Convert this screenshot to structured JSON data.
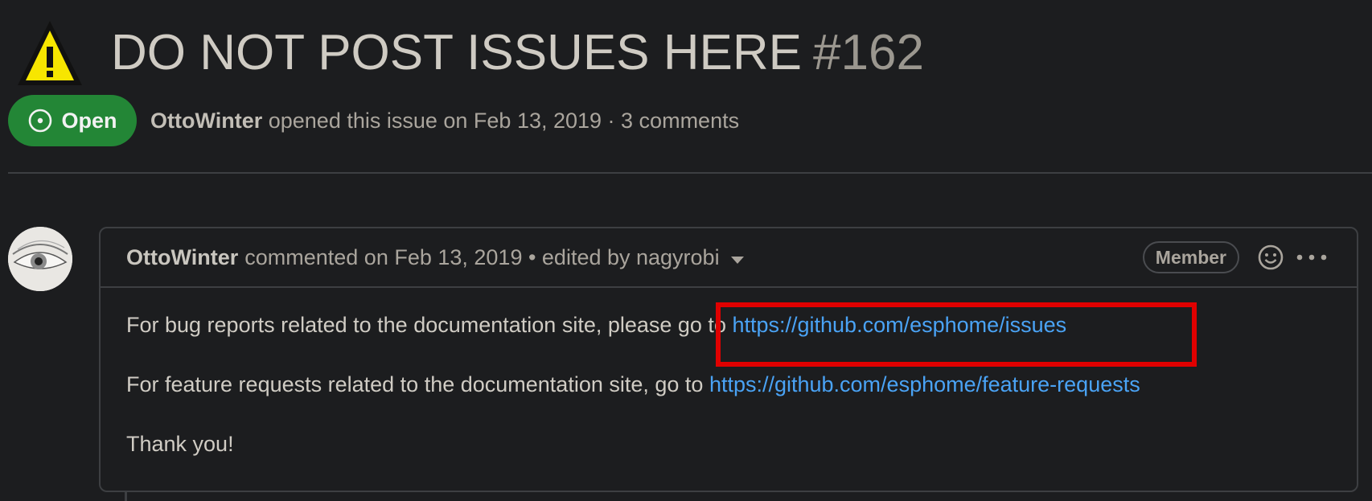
{
  "issue": {
    "title": "DO NOT POST ISSUES HERE",
    "number": "#162",
    "state": "Open",
    "state_color": "#238636",
    "author": "OttoWinter",
    "meta_text": " opened this issue on Feb 13, 2019 · 3 comments"
  },
  "comment": {
    "author": "OttoWinter",
    "meta_text": "commented on Feb 13, 2019 • edited by nagyrobi",
    "role": "Member",
    "paragraphs": [
      {
        "text": "For bug reports related to the documentation site, please go to ",
        "link": "https://github.com/esphome/issues"
      },
      {
        "text": "For feature requests related to the documentation site, go to ",
        "link": "https://github.com/esphome/feature-requests"
      },
      {
        "text": "Thank you!"
      }
    ]
  },
  "icons": {
    "warning": "warning-icon",
    "state": "issue-open-icon",
    "reaction": "smiley-icon",
    "more": "kebab-horizontal-icon",
    "edit_history": "triangle-down-icon"
  },
  "colors": {
    "highlight": "#e00000",
    "link": "#4aa3f5"
  }
}
